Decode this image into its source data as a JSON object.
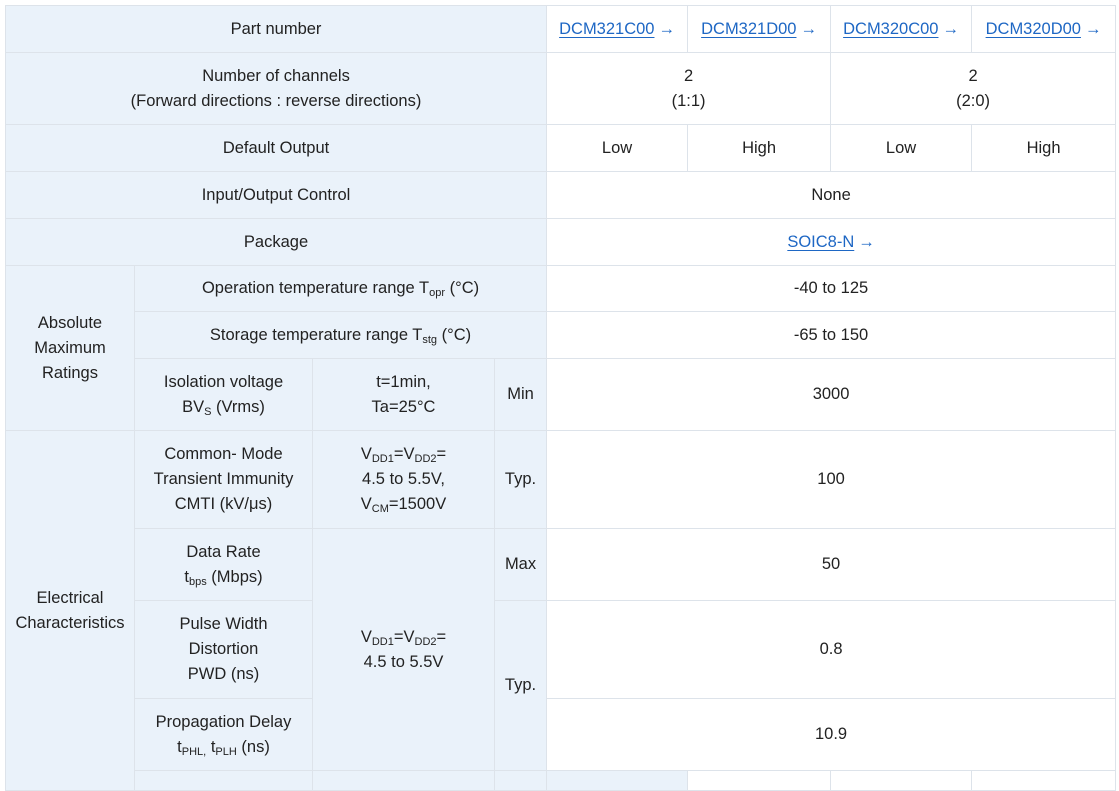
{
  "part_number": {
    "label": "Part number",
    "parts": [
      "DCM321C00",
      "DCM321D00",
      "DCM320C00",
      "DCM320D00"
    ],
    "arrow": "→"
  },
  "channels": {
    "label_line1": "Number of channels",
    "label_line2": "(Forward directions : reverse directions)",
    "group1_count": "2",
    "group1_ratio": "(1:1)",
    "group2_count": "2",
    "group2_ratio": "(2:0)"
  },
  "default_output": {
    "label": "Default Output",
    "values": [
      "Low",
      "High",
      "Low",
      "High"
    ]
  },
  "io_control": {
    "label": "Input/Output Control",
    "value": "None"
  },
  "package": {
    "label": "Package",
    "value": "SOIC8-N"
  },
  "abs_max": {
    "group_label_1": "Absolute",
    "group_label_2": "Maximum",
    "group_label_3": "Ratings",
    "op_temp": {
      "label_pre": "Operation temperature range T",
      "label_sub": "opr",
      "label_post": " (°C)",
      "value": "-40 to 125"
    },
    "storage_temp": {
      "label_pre": "Storage temperature range T",
      "label_sub": "stg",
      "label_post": " (°C)",
      "value": "-65 to 150"
    },
    "isolation": {
      "label_line1": "Isolation voltage",
      "label_line2_pre": "BV",
      "label_line2_sub": "S",
      "label_line2_post": " (Vrms)",
      "cond_line1": "t=1min,",
      "cond_line2": "Ta=25°C",
      "type": "Min",
      "value": "3000"
    }
  },
  "electrical": {
    "group_label_1": "Electrical",
    "group_label_2": "Characteristics",
    "cmti": {
      "label_line1": "Common- Mode",
      "label_line2": "Transient Immunity",
      "label_line3": "CMTI (kV/μs)",
      "cond_v1": "V",
      "cond_sub1": "DD1",
      "cond_eq": "=V",
      "cond_sub2": "DD2",
      "cond_tail": "=",
      "cond_line2": "4.5 to 5.5V,",
      "cond_line3_pre": "V",
      "cond_line3_sub": "CM",
      "cond_line3_post": "=1500V",
      "type": "Typ.",
      "value": "100"
    },
    "shared_cond": {
      "v1": "V",
      "sub1": "DD1",
      "eq": "=V",
      "sub2": "DD2",
      "tail": "=",
      "line2": "4.5 to 5.5V"
    },
    "data_rate": {
      "label_line1": "Data Rate",
      "label_line2_pre": "t",
      "label_line2_sub": "bps",
      "label_line2_post": " (Mbps)",
      "type": "Max",
      "value": "50"
    },
    "pwd": {
      "label_line1": "Pulse Width",
      "label_line2": "Distortion",
      "label_line3": "PWD (ns)",
      "type": "Typ.",
      "value": "0.8"
    },
    "prop_delay": {
      "label_line1": "Propagation Delay",
      "label_line2_pre": "t",
      "label_line2_sub1": "PHL,",
      "label_line2_mid": " t",
      "label_line2_sub2": "PLH",
      "label_line2_post": " (ns)",
      "value": "10.9"
    }
  },
  "colors": {
    "header_bg": "#eaf2fa",
    "link": "#1e67c4",
    "border": "#dde3ea"
  }
}
